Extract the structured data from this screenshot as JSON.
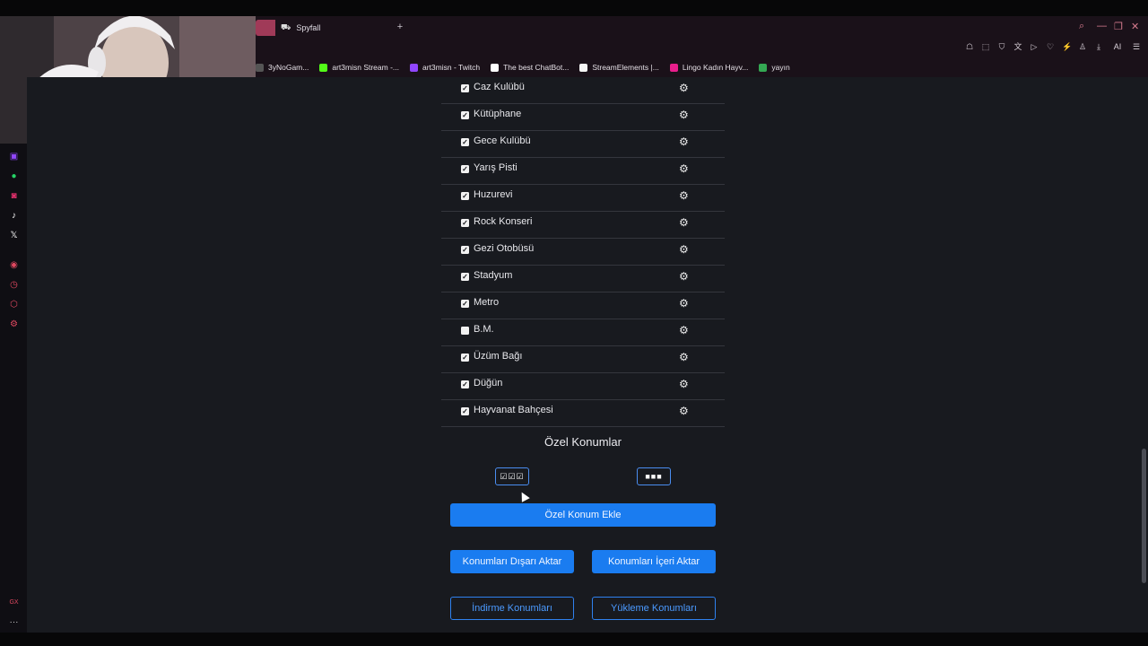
{
  "browser": {
    "tab_title": "Spyfall",
    "new_tab_symbol": "+",
    "window_controls": [
      "⌕",
      "—",
      "❐",
      "✕"
    ],
    "toolbar_icons": [
      "☖",
      "⬚",
      "⛉",
      "文",
      "▷",
      "♡",
      "⚡",
      "♙",
      "⤓",
      "AI",
      "☰"
    ]
  },
  "bookmarks": [
    {
      "label": "3yNoGam...",
      "color": "#555555"
    },
    {
      "label": "art3misn Stream -...",
      "color": "#53fc18"
    },
    {
      "label": "art3misn - Twitch",
      "color": "#9146ff"
    },
    {
      "label": "The best ChatBot...",
      "color": "#ffffff"
    },
    {
      "label": "StreamElements |...",
      "color": "#f5f5f5"
    },
    {
      "label": "Lingo Kadın Hayv...",
      "color": "#e91e8c"
    },
    {
      "label": "yayın",
      "color": "#34a853"
    }
  ],
  "sidebar_icons": [
    "twitch-icon",
    "whatsapp-icon",
    "instagram-icon",
    "tiktok-icon",
    "x-icon",
    "player-icon",
    "history-icon",
    "extensions-icon",
    "settings-icon",
    "gx-icon",
    "more-icon"
  ],
  "sidebar_labels": {
    "gx": "GX",
    "more": "···"
  },
  "locations": [
    {
      "name": "Caz Kulübü",
      "checked": true
    },
    {
      "name": "Kütüphane",
      "checked": true
    },
    {
      "name": "Gece Kulübü",
      "checked": true
    },
    {
      "name": "Yarış Pisti",
      "checked": true
    },
    {
      "name": "Huzurevi",
      "checked": true
    },
    {
      "name": "Rock Konseri",
      "checked": true
    },
    {
      "name": "Gezi Otobüsü",
      "checked": true
    },
    {
      "name": "Stadyum",
      "checked": true
    },
    {
      "name": "Metro",
      "checked": true
    },
    {
      "name": "B.M.",
      "checked": false
    },
    {
      "name": "Üzüm Bağı",
      "checked": true
    },
    {
      "name": "Düğün",
      "checked": true
    },
    {
      "name": "Hayvanat Bahçesi",
      "checked": true
    }
  ],
  "custom": {
    "title": "Özel Konumlar",
    "select_all_label": "☑☑☑",
    "deselect_all_label": "■■■",
    "add_button": "Özel Konum Ekle",
    "export_button": "Konumları Dışarı Aktar",
    "import_button": "Konumları İçeri Aktar",
    "download_button": "İndirme Konumları",
    "upload_button": "Yükleme Konumları"
  }
}
